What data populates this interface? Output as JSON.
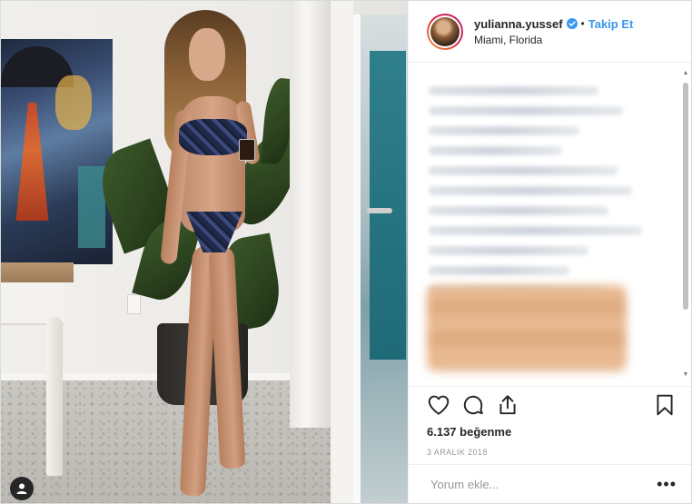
{
  "post": {
    "user": {
      "username": "yulianna.yussef",
      "verified": true,
      "follow_label": "Takip Et",
      "separator": "•",
      "location": "Miami, Florida"
    },
    "likes_text": "6.137 beğenme",
    "date_text": "3 ARALIK 2018",
    "comment_placeholder": "Yorum ekle...",
    "more_label": "•••",
    "actions": [
      "heart-icon",
      "comment-icon",
      "share-icon",
      "bookmark-icon"
    ]
  },
  "colors": {
    "accent": "#3897f0",
    "text": "#262626",
    "muted": "#999999",
    "border": "#efefef"
  }
}
